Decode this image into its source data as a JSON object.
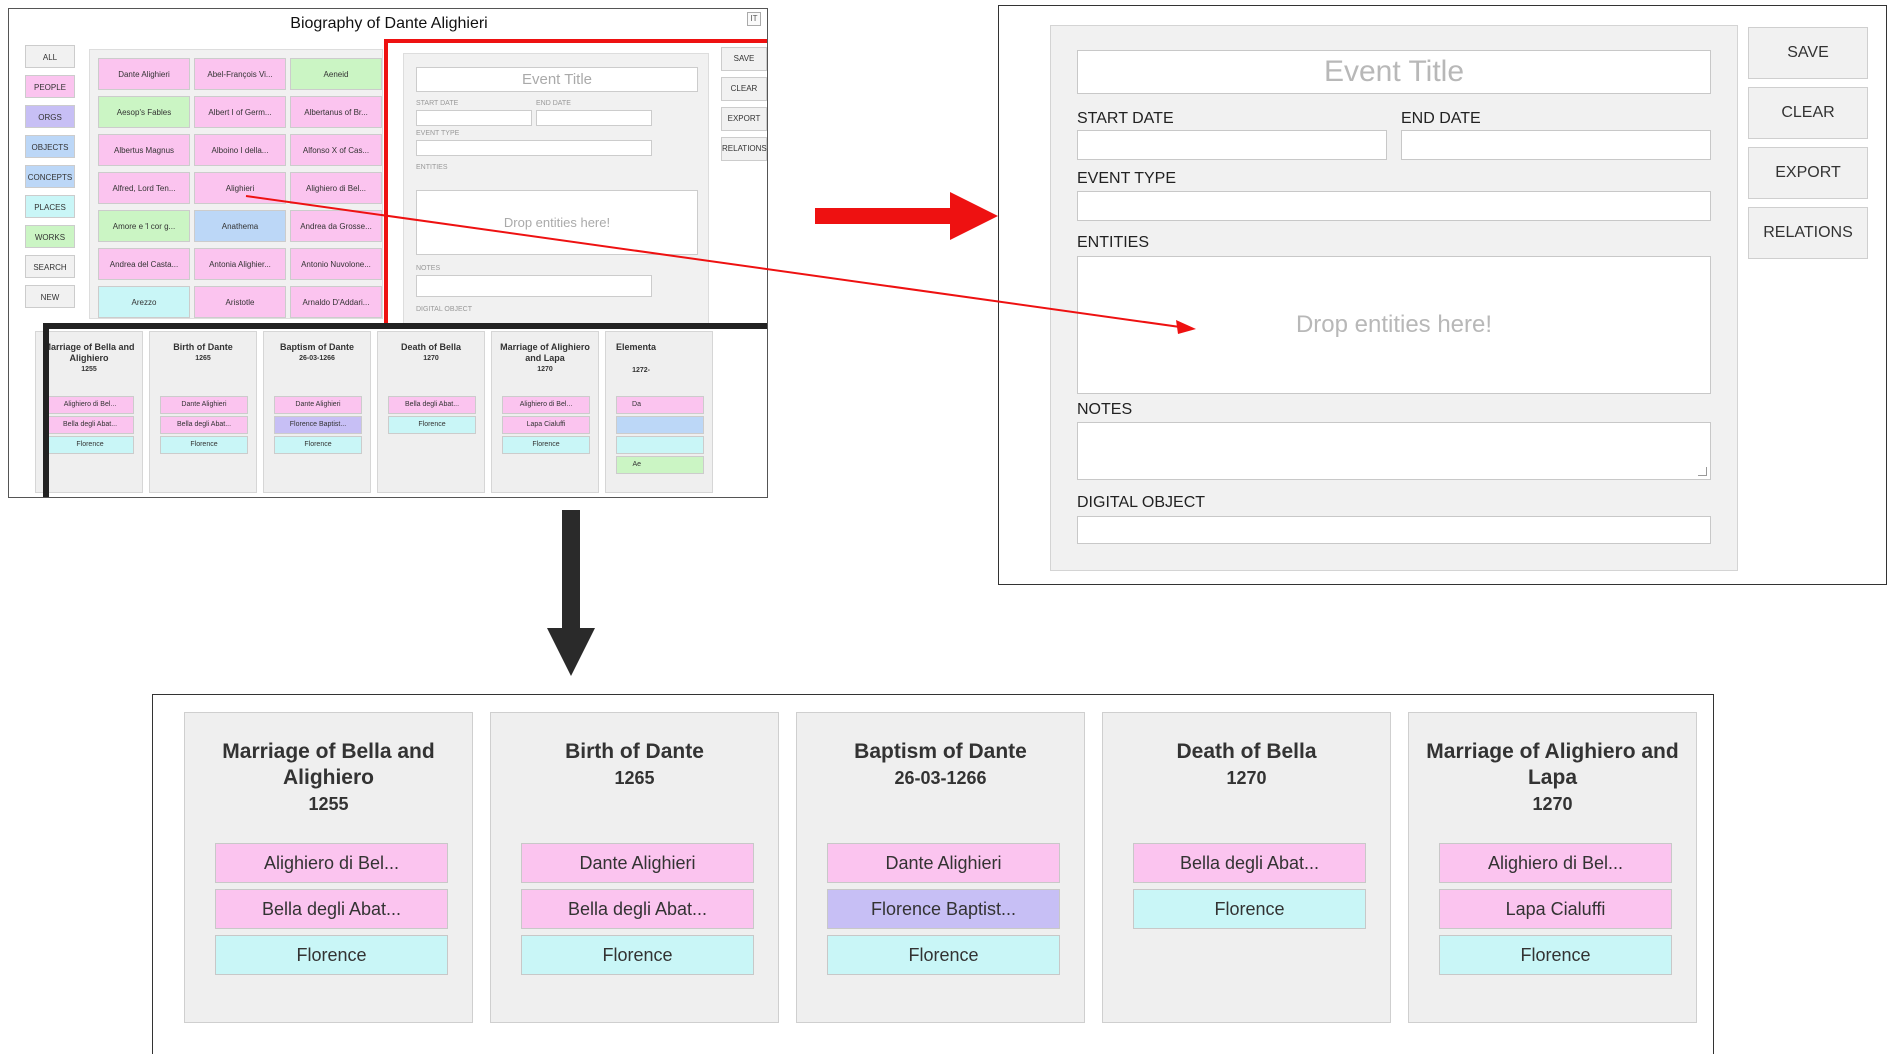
{
  "app": {
    "title": "Biography of Dante Alighieri",
    "lang": "IT"
  },
  "filters": [
    {
      "label": "ALL",
      "color": "#f1f1f1"
    },
    {
      "label": "PEOPLE",
      "color": "#fbc4ef"
    },
    {
      "label": "ORGS",
      "color": "#c7bff5"
    },
    {
      "label": "OBJECTS",
      "color": "#bcd7f7"
    },
    {
      "label": "CONCEPTS",
      "color": "#bcd7f7"
    },
    {
      "label": "PLACES",
      "color": "#c9f6f7"
    },
    {
      "label": "WORKS",
      "color": "#cbf5c4"
    },
    {
      "label": "SEARCH",
      "color": "#f1f1f1"
    },
    {
      "label": "NEW",
      "color": "#f1f1f1"
    }
  ],
  "entities": [
    {
      "label": "Dante Alighieri",
      "color": "#fbc4ef"
    },
    {
      "label": "Abel-François Vi...",
      "color": "#fbc4ef"
    },
    {
      "label": "Aeneid",
      "color": "#cbf5c4"
    },
    {
      "label": "Aesop's Fables",
      "color": "#cbf5c4"
    },
    {
      "label": "Albert I of Germ...",
      "color": "#fbc4ef"
    },
    {
      "label": "Albertanus of Br...",
      "color": "#fbc4ef"
    },
    {
      "label": "Albertus Magnus",
      "color": "#fbc4ef"
    },
    {
      "label": "Alboino I della...",
      "color": "#fbc4ef"
    },
    {
      "label": "Alfonso X of Cas...",
      "color": "#fbc4ef"
    },
    {
      "label": "Alfred, Lord Ten...",
      "color": "#fbc4ef"
    },
    {
      "label": "Alighieri",
      "color": "#fbc4ef"
    },
    {
      "label": "Alighiero di Bel...",
      "color": "#fbc4ef"
    },
    {
      "label": "Amore e 'l cor g...",
      "color": "#cbf5c4"
    },
    {
      "label": "Anathema",
      "color": "#bcd7f7"
    },
    {
      "label": "Andrea da Grosse...",
      "color": "#fbc4ef"
    },
    {
      "label": "Andrea del Casta...",
      "color": "#fbc4ef"
    },
    {
      "label": "Antonia Alighier...",
      "color": "#fbc4ef"
    },
    {
      "label": "Antonio Nuvolone...",
      "color": "#fbc4ef"
    },
    {
      "label": "Arezzo",
      "color": "#c9f6f7"
    },
    {
      "label": "Aristotle",
      "color": "#fbc4ef"
    },
    {
      "label": "Arnaldo D'Addari...",
      "color": "#fbc4ef"
    }
  ],
  "form": {
    "event_title_placeholder": "Event Title",
    "start_date_label": "START DATE",
    "end_date_label": "END DATE",
    "event_type_label": "EVENT TYPE",
    "entities_label": "ENTITIES",
    "drop_placeholder": "Drop entities here!",
    "notes_label": "NOTES",
    "digital_object_label": "DIGITAL OBJECT"
  },
  "actions": {
    "save": "SAVE",
    "clear": "CLEAR",
    "export": "EXPORT",
    "relations": "RELATIONS"
  },
  "events": [
    {
      "title": "Marriage of Bella and Alighiero",
      "date": "1255",
      "entities": [
        {
          "label": "Alighiero di Bel...",
          "color": "#fbc4ef"
        },
        {
          "label": "Bella degli Abat...",
          "color": "#fbc4ef"
        },
        {
          "label": "Florence",
          "color": "#c9f6f7"
        }
      ]
    },
    {
      "title": "Birth of Dante",
      "date": "1265",
      "entities": [
        {
          "label": "Dante Alighieri",
          "color": "#fbc4ef"
        },
        {
          "label": "Bella degli Abat...",
          "color": "#fbc4ef"
        },
        {
          "label": "Florence",
          "color": "#c9f6f7"
        }
      ]
    },
    {
      "title": "Baptism of Dante",
      "date": "26-03-1266",
      "entities": [
        {
          "label": "Dante Alighieri",
          "color": "#fbc4ef"
        },
        {
          "label": "Florence Baptist...",
          "color": "#c7bff5"
        },
        {
          "label": "Florence",
          "color": "#c9f6f7"
        }
      ]
    },
    {
      "title": "Death of Bella",
      "date": "1270",
      "entities": [
        {
          "label": "Bella degli Abat...",
          "color": "#fbc4ef"
        },
        {
          "label": "Florence",
          "color": "#c9f6f7"
        }
      ]
    },
    {
      "title": "Marriage of Alighiero and Lapa",
      "date": "1270",
      "entities": [
        {
          "label": "Alighiero di Bel...",
          "color": "#fbc4ef"
        },
        {
          "label": "Lapa Cialuffi",
          "color": "#fbc4ef"
        },
        {
          "label": "Florence",
          "color": "#c9f6f7"
        }
      ]
    }
  ],
  "partial_event": {
    "title": "Elementa",
    "date": "1272-",
    "chips": [
      {
        "label": "Da",
        "color": "#fbc4ef"
      },
      {
        "label": "",
        "color": "#bcd7f7"
      },
      {
        "label": "",
        "color": "#c9f6f7"
      },
      {
        "label": "Ae",
        "color": "#cbf5c4"
      }
    ]
  }
}
